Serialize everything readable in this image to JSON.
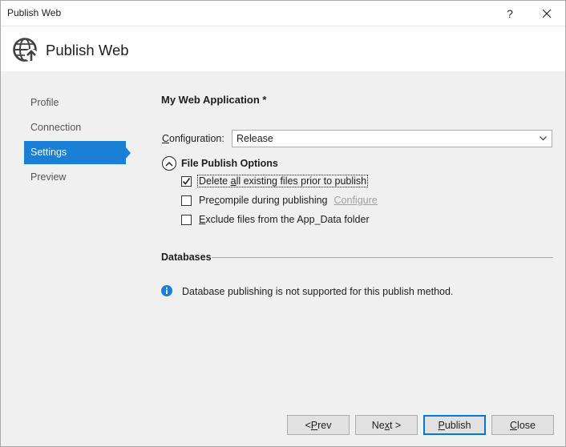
{
  "window": {
    "title": "Publish Web",
    "help_label": "?"
  },
  "header": {
    "title": "Publish Web",
    "icon": "globe-publish-icon"
  },
  "sidebar": {
    "items": [
      {
        "label": "Profile",
        "active": false
      },
      {
        "label": "Connection",
        "active": false
      },
      {
        "label": "Settings",
        "active": true
      },
      {
        "label": "Preview",
        "active": false
      }
    ]
  },
  "main": {
    "app_title": "My Web Application *",
    "configuration": {
      "label_accel": "C",
      "label_rest": "onfiguration:",
      "value": "Release"
    },
    "file_publish_options": {
      "label": "File Publish Options",
      "expanded": true,
      "options": [
        {
          "pre": "Delete ",
          "accel": "a",
          "post": "ll existing files prior to publish",
          "checked": true
        },
        {
          "pre": "Pre",
          "accel": "c",
          "post": "ompile during publishing",
          "checked": false
        },
        {
          "pre": "",
          "accel": "E",
          "post": "xclude files from the App_Data folder",
          "checked": false
        }
      ],
      "configure_link": "Configure"
    },
    "databases": {
      "label": "Databases",
      "info_text": "Database publishing is not supported for this publish method."
    }
  },
  "buttons": {
    "prev": {
      "pre": "< ",
      "accel": "P",
      "post": "rev"
    },
    "next": {
      "pre": "Ne",
      "accel": "x",
      "post": "t >"
    },
    "publish": {
      "pre": "",
      "accel": "P",
      "post": "ublish"
    },
    "close": {
      "pre": "",
      "accel": "C",
      "post": "lose"
    }
  },
  "colors": {
    "accent": "#1c7fd6",
    "info": "#1c7fd6"
  }
}
